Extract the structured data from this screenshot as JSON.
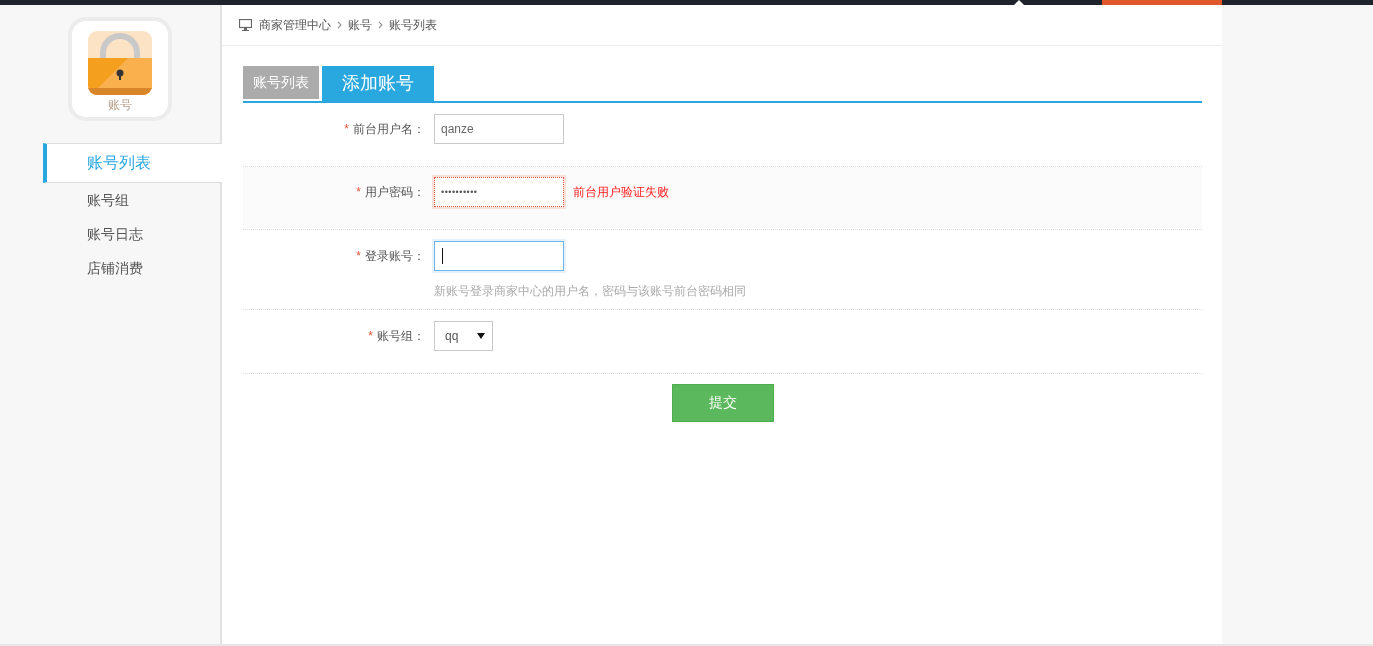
{
  "sidebar": {
    "app_label": "账号",
    "menu": [
      {
        "label": "账号列表",
        "selected": true
      },
      {
        "label": "账号组",
        "selected": false
      },
      {
        "label": "账号日志",
        "selected": false
      },
      {
        "label": "店铺消费",
        "selected": false
      }
    ]
  },
  "breadcrumb": [
    "商家管理中心",
    "账号",
    "账号列表"
  ],
  "tabs": [
    {
      "label": "账号列表",
      "selected": false
    },
    {
      "label": "添加账号",
      "selected": true
    }
  ],
  "form": {
    "fields": [
      {
        "kind": "text",
        "required_mark": "*",
        "label": "前台用户名：",
        "value": "qanze",
        "focused": false,
        "invalid": false
      },
      {
        "kind": "password",
        "required_mark": "*",
        "label": "用户密码：",
        "value": "••••••••••",
        "focused": false,
        "invalid": true,
        "error": "前台用户验证失败"
      },
      {
        "kind": "text",
        "required_mark": "*",
        "label": "登录账号：",
        "focused": true,
        "invalid": false,
        "hint": "新账号登录商家中心的用户名，密码与该账号前台密码相同"
      },
      {
        "kind": "select",
        "required_mark": "*",
        "label": "账号组：",
        "value": "qq",
        "focused": false,
        "invalid": false
      }
    ],
    "submit": "提交"
  }
}
